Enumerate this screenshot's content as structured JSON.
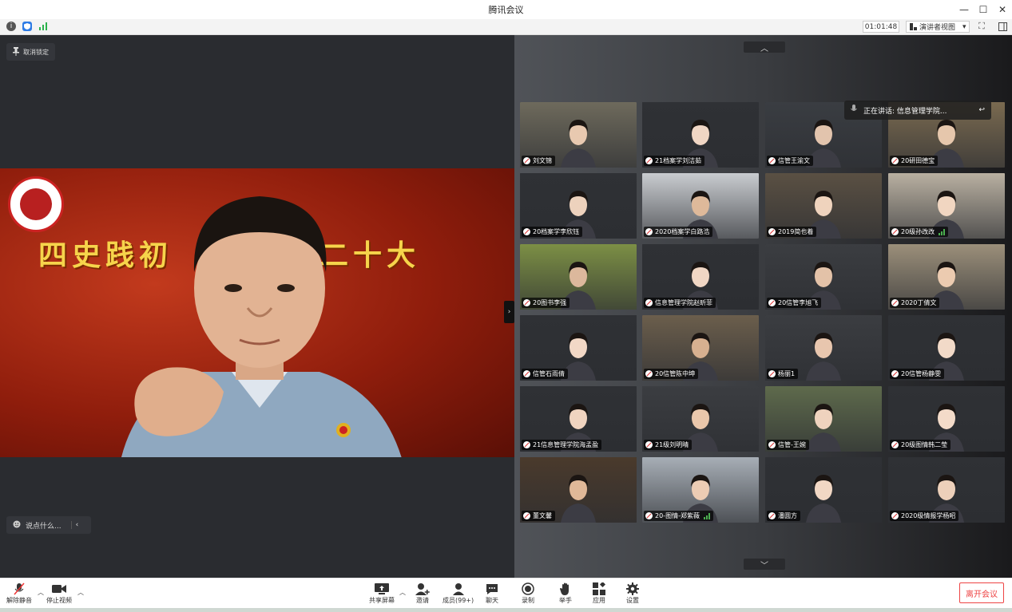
{
  "window": {
    "title": "腾讯会议",
    "minimize": "—",
    "maximize": "☐",
    "close": "✕"
  },
  "statusbar": {
    "timer": "01:01:48",
    "view_label": "演讲者视图",
    "view_caret": "▾",
    "icons": [
      "info-icon",
      "shield-icon",
      "signal-icon",
      "fullscreen-icon",
      "sidebar-icon"
    ]
  },
  "main": {
    "unpin_label": "取消锁定",
    "banner_left": "四史践初",
    "banner_right": "二十大",
    "chat_placeholder": "说点什么...",
    "collapse_glyph": "›"
  },
  "gallery": {
    "page_up": "︿",
    "page_down": "﹀",
    "speaking_label": "正在讲话: 信息管理学院...",
    "tiles": [
      {
        "name": "刘文锦",
        "bg": "#6e6a5c",
        "skin": "#e8c9b0",
        "bars": false
      },
      {
        "name": "21档案学刘洁茹",
        "bg": "#2f3135",
        "skin": "#f0d6c4",
        "bars": false
      },
      {
        "name": "信管王渝文",
        "bg": "#3a3d42",
        "skin": "#e2c4ad",
        "bars": false
      },
      {
        "name": "20研田德宝",
        "bg": "#7a6a50",
        "skin": "#e6c7ac",
        "bars": false
      },
      {
        "name": "20档案学李欣钰",
        "bg": "#2f3135",
        "skin": "#edd2bd",
        "bars": false
      },
      {
        "name": "2020档案学白路浩",
        "bg": "#c9ccd0",
        "skin": "#deb99a",
        "bars": false
      },
      {
        "name": "2019简也着",
        "bg": "#5a5043",
        "skin": "#efd3bd",
        "bars": false
      },
      {
        "name": "20级孙改改",
        "bg": "#b9b0a1",
        "skin": "#f1d6c1",
        "bars": true
      },
      {
        "name": "20图书李强",
        "bg": "#7c8f45",
        "skin": "#dcb89c",
        "bars": false
      },
      {
        "name": "信息管理学院赵昕菲",
        "bg": "#2f3135",
        "skin": "#f0d6c4",
        "bars": false
      },
      {
        "name": "20信管李旭飞",
        "bg": "#3b3d41",
        "skin": "#e3c2a8",
        "bars": false
      },
      {
        "name": "2020丁倩文",
        "bg": "#9b8f7a",
        "skin": "#eccbb0",
        "bars": false
      },
      {
        "name": "信管石雨倩",
        "bg": "#2f3135",
        "skin": "#f2d8c6",
        "bars": false
      },
      {
        "name": "20信管陈中坤",
        "bg": "#6b5e4c",
        "skin": "#d7b090",
        "bars": false
      },
      {
        "name": "杨丽1",
        "bg": "#3b3d41",
        "skin": "#e8c6ae",
        "bars": false
      },
      {
        "name": "20信管杨静雯",
        "bg": "#2f3135",
        "skin": "#f2dac8",
        "bars": false
      },
      {
        "name": "21信息管理学院海孟盈",
        "bg": "#2f3135",
        "skin": "#f0d4c0",
        "bars": false
      },
      {
        "name": "21级刘明晴",
        "bg": "#3b3d41",
        "skin": "#eac7ab",
        "bars": false
      },
      {
        "name": "信管-王婉",
        "bg": "#5e6a4c",
        "skin": "#efd3be",
        "bars": false
      },
      {
        "name": "20级图情韩二莹",
        "bg": "#2f3135",
        "skin": "#f3dbc9",
        "bars": false
      },
      {
        "name": "董文馨",
        "bg": "#4a3a2c",
        "skin": "#e0b898",
        "bars": false
      },
      {
        "name": "20-图情-郑紫薇",
        "bg": "#a7aeb6",
        "skin": "#ecccb4",
        "bars": true
      },
      {
        "name": "潘圆方",
        "bg": "#2f3135",
        "skin": "#f1d7c4",
        "bars": false
      },
      {
        "name": "2020级情报学杨昭",
        "bg": "#2f3135",
        "skin": "#edd0ba",
        "bars": false
      }
    ]
  },
  "toolbar": {
    "unmute": "解除静音",
    "stop_video": "停止视频",
    "share_screen": "共享屏幕",
    "invite": "邀请",
    "members": "成员(99+)",
    "chat": "聊天",
    "record": "录制",
    "raise_hand": "举手",
    "apps": "应用",
    "settings": "设置",
    "leave": "离开会议"
  },
  "colors": {
    "accent_red": "#e44444",
    "toolbar_bg": "#ffffff",
    "gallery_bg": "#3a3c40"
  }
}
